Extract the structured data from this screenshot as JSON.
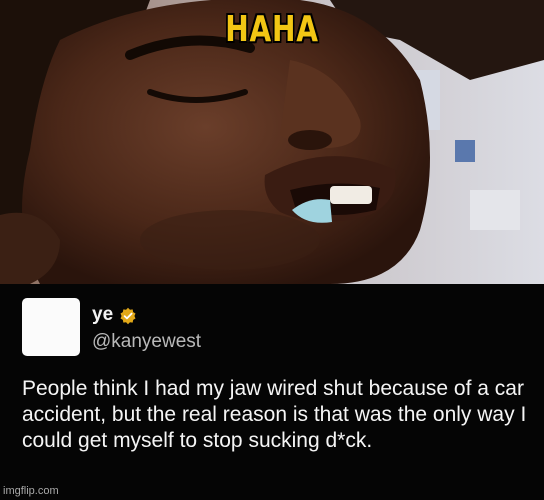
{
  "caption": "HAHA",
  "tweet": {
    "name": "ye",
    "handle": "@kanyewest",
    "text": "People think I had my jaw wired shut because of a car accident, but the real reason is that was the only way I could get myself to stop sucking d*ck."
  },
  "watermark": "imgflip.com",
  "icons": {
    "verified": "verified-badge-icon",
    "avatar": "blank-avatar"
  },
  "colors": {
    "caption": "#f2c614",
    "badge": "#e2a818",
    "tweet_background": "#050505"
  }
}
